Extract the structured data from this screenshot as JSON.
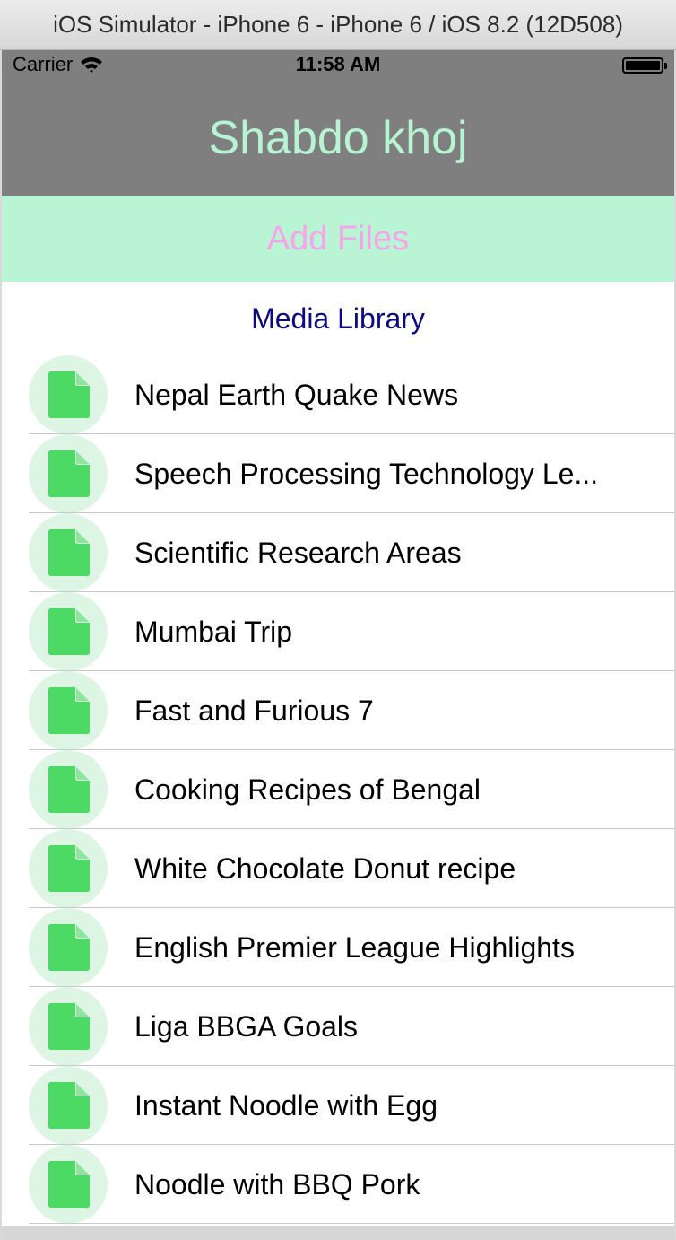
{
  "window": {
    "title": "iOS Simulator - iPhone 6 - iPhone 6 / iOS 8.2 (12D508)"
  },
  "status_bar": {
    "carrier": "Carrier",
    "time": "11:58 AM",
    "icons": [
      "wifi-icon",
      "battery-icon"
    ]
  },
  "nav": {
    "title": "Shabdo khoj"
  },
  "actions": {
    "add_files_label": "Add Files"
  },
  "section": {
    "header": "Media Library"
  },
  "files": [
    {
      "title": "Nepal Earth Quake News",
      "icon": "document-icon"
    },
    {
      "title": "Speech Processing Technology Le...",
      "icon": "document-icon"
    },
    {
      "title": "Scientific Research Areas",
      "icon": "document-icon"
    },
    {
      "title": "Mumbai Trip",
      "icon": "document-icon"
    },
    {
      "title": "Fast and Furious 7",
      "icon": "document-icon"
    },
    {
      "title": "Cooking Recipes of Bengal",
      "icon": "document-icon"
    },
    {
      "title": "White Chocolate Donut recipe",
      "icon": "document-icon"
    },
    {
      "title": "English Premier League Highlights",
      "icon": "document-icon"
    },
    {
      "title": "Liga BBGA Goals",
      "icon": "document-icon"
    },
    {
      "title": "Instant Noodle with Egg",
      "icon": "document-icon"
    },
    {
      "title": "Noodle with BBQ Pork",
      "icon": "document-icon"
    }
  ],
  "colors": {
    "nav_background": "#7f7f7f",
    "nav_title": "#b6f4d2",
    "add_files_background": "#b9f5d4",
    "add_files_text": "#f6a5ea",
    "section_header_text": "#0a0a84",
    "icon_circle": "#dcf6e3",
    "icon_doc": "#4cd964"
  }
}
